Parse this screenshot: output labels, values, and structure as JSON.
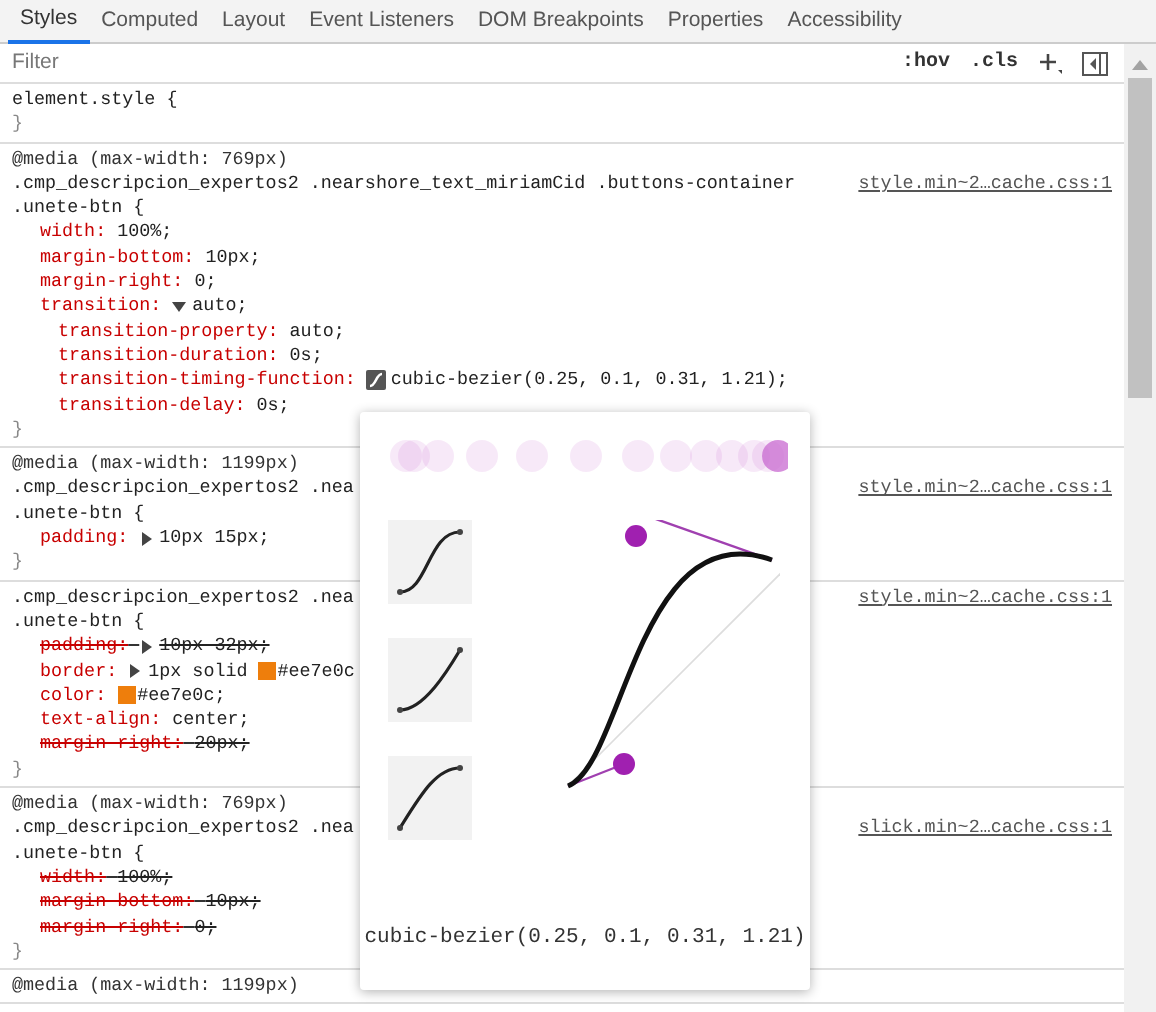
{
  "tabs": [
    {
      "label": "Styles",
      "selected": true
    },
    {
      "label": "Computed",
      "selected": false
    },
    {
      "label": "Layout",
      "selected": false
    },
    {
      "label": "Event Listeners",
      "selected": false
    },
    {
      "label": "DOM Breakpoints",
      "selected": false
    },
    {
      "label": "Properties",
      "selected": false
    },
    {
      "label": "Accessibility",
      "selected": false
    }
  ],
  "filter": {
    "placeholder": "Filter",
    "buttons": [
      ":hov",
      ".cls"
    ]
  },
  "rules": [
    {
      "selector": [
        "element.style {"
      ],
      "close": "}"
    },
    {
      "media": "@media (max-width: 769px)",
      "selector": [
        ".cmp_descripcion_expertos2 .nearshore_text_miriamCid .buttons-container",
        ".unete-btn {"
      ],
      "source": "style.min~2…cache.css:1",
      "declarations": [
        {
          "name": "width:",
          "value": "100%;",
          "overridden": false
        },
        {
          "name": "margin-bottom:",
          "value": "10px;",
          "overridden": false
        },
        {
          "name": "margin-right:",
          "value": "0;",
          "overridden": false
        },
        {
          "name": "transition:",
          "value": "auto;",
          "overridden": false,
          "expanded": true,
          "children": [
            {
              "name": "transition-property:",
              "value": "auto;",
              "overridden": false
            },
            {
              "name": "transition-duration:",
              "value": "0s;",
              "overridden": false
            },
            {
              "name": "transition-timing-function:",
              "value": "cubic-bezier(0.25, 0.1, 0.31, 1.21);",
              "overridden": false,
              "kind": "bezier"
            },
            {
              "name": "transition-delay:",
              "value": "0s;",
              "overridden": false
            }
          ]
        }
      ],
      "close": "}"
    },
    {
      "media": "@media (max-width: 1199px)",
      "selector": [
        ".cmp_descripcion_expertos2 .nea",
        ".unete-btn {"
      ],
      "source": "style.min~2…cache.css:1",
      "declarations": [
        {
          "name": "padding:",
          "value": "10px 15px;",
          "overridden": false,
          "expanded": false
        }
      ],
      "close": "}"
    },
    {
      "selector": [
        ".cmp_descripcion_expertos2 .nea",
        ".unete-btn {"
      ],
      "source": "style.min~2…cache.css:1",
      "declarations": [
        {
          "name": "padding:",
          "value": "10px 32px;",
          "overridden": true,
          "expanded": false
        },
        {
          "name": "border:",
          "value": "1px solid",
          "overridden": false,
          "expanded": false,
          "color_value": "#ee7e0c"
        },
        {
          "name": "color:",
          "overridden": false,
          "color_value": "#ee7e0c",
          "suffix": ";"
        },
        {
          "name": "text-align:",
          "value": "center;",
          "overridden": false
        },
        {
          "name": "margin-right:",
          "value": "20px;",
          "overridden": true
        }
      ],
      "close": "}"
    },
    {
      "media": "@media (max-width: 769px)",
      "selector": [
        ".cmp_descripcion_expertos2 .nea",
        ".unete-btn {"
      ],
      "source": "slick.min~2…cache.css:1",
      "declarations": [
        {
          "name": "width:",
          "value": "100%;",
          "overridden": true
        },
        {
          "name": "margin-bottom:",
          "value": "10px;",
          "overridden": true
        },
        {
          "name": "margin-right:",
          "value": "0;",
          "overridden": true
        }
      ],
      "close": "}"
    },
    {
      "media": "@media (max-width: 1199px)"
    }
  ],
  "bezier_editor": {
    "label": "cubic-bezier(0.25, 0.1, 0.31, 1.21)"
  }
}
